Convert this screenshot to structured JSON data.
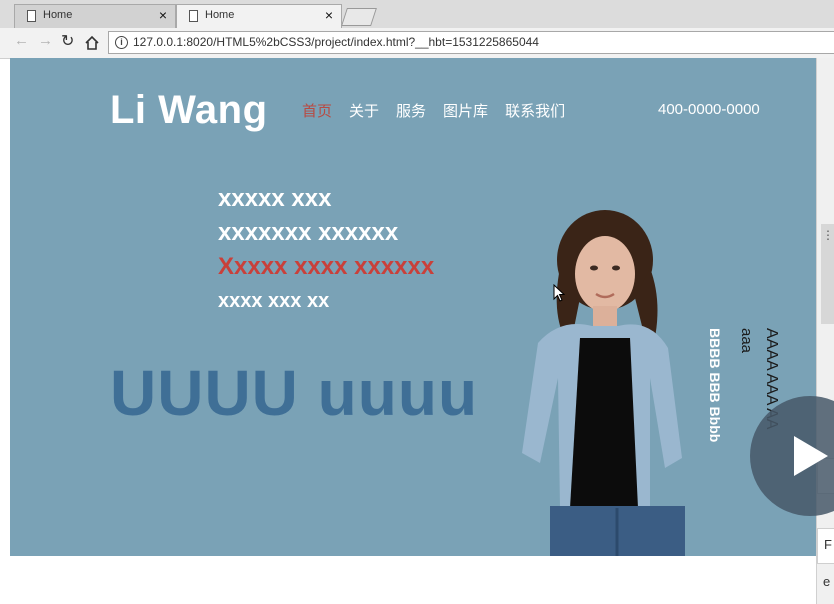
{
  "browser": {
    "tabs": [
      {
        "title": "Home"
      },
      {
        "title": "Home"
      }
    ],
    "close_glyph": "×",
    "url": "127.0.0.1:8020/HTML5%2bCSS3/project/index.html?__hbt=1531225865044",
    "icons": [
      "back-icon",
      "forward-icon",
      "reload-icon",
      "home-icon",
      "info-icon"
    ]
  },
  "page": {
    "logo": "Li Wang",
    "menu": [
      "首页",
      "关于",
      "服务",
      "图片库",
      "联系我们"
    ],
    "phone": "400-0000-0000",
    "headline_lines": [
      "xxxxx xxx",
      "xxxxxxx xxxxxx",
      "Xxxxx xxxx xxxxxx",
      "xxxx xxx xx"
    ],
    "big_text": "UUUU uuuu",
    "vertical_texts": [
      "AAAA AAA AA",
      "aaa",
      "BBBB BBB Bbbb"
    ]
  },
  "overlay": {
    "side_chars": [
      "F",
      "e"
    ]
  },
  "colors": {
    "hero_bg": "#7aa2b6",
    "active_menu": "#b84a42",
    "big_text": "#3f6f96",
    "accent_red": "#c9403a"
  }
}
